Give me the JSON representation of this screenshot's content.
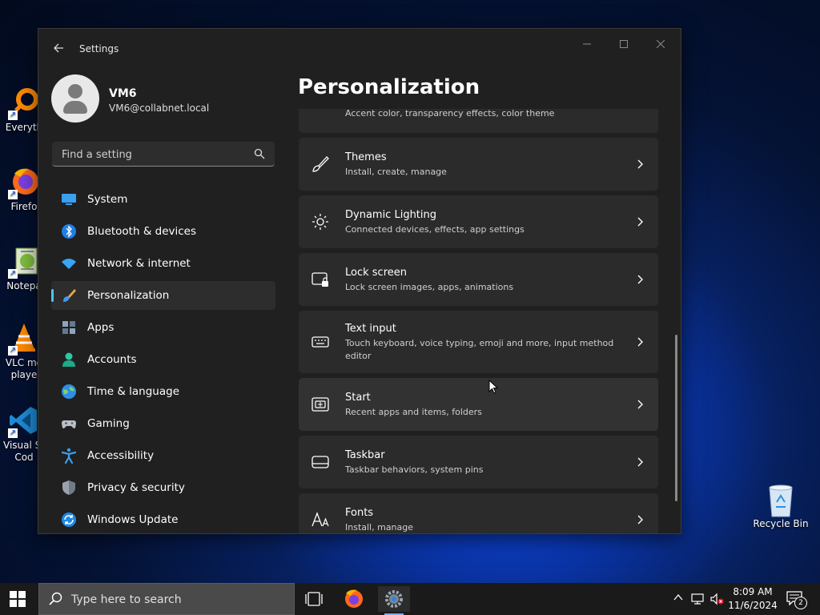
{
  "desktop": {
    "icons": [
      {
        "label": "Everyth",
        "icon": "everything-icon"
      },
      {
        "label": "Firefo",
        "icon": "firefox-icon"
      },
      {
        "label": "Notepa",
        "icon": "notepad-icon"
      },
      {
        "label": "VLC me",
        "label2": "playe",
        "icon": "vlc-icon"
      },
      {
        "label": "Visual St",
        "label2": "Cod",
        "icon": "vscode-icon"
      },
      {
        "label": "Recycle Bin",
        "icon": "recycle-bin-icon"
      }
    ]
  },
  "window": {
    "title": "Settings",
    "controls": {
      "minimize": "—",
      "maximize": "☐",
      "close": "✕"
    }
  },
  "profile": {
    "name": "VM6",
    "email": "VM6@collabnet.local"
  },
  "search": {
    "placeholder": "Find a setting"
  },
  "nav": {
    "items": [
      {
        "label": "System",
        "icon": "system-icon"
      },
      {
        "label": "Bluetooth & devices",
        "icon": "bluetooth-icon"
      },
      {
        "label": "Network & internet",
        "icon": "network-icon"
      },
      {
        "label": "Personalization",
        "icon": "personalization-icon",
        "active": true
      },
      {
        "label": "Apps",
        "icon": "apps-icon"
      },
      {
        "label": "Accounts",
        "icon": "accounts-icon"
      },
      {
        "label": "Time & language",
        "icon": "time-language-icon"
      },
      {
        "label": "Gaming",
        "icon": "gaming-icon"
      },
      {
        "label": "Accessibility",
        "icon": "accessibility-icon"
      },
      {
        "label": "Privacy & security",
        "icon": "privacy-icon"
      },
      {
        "label": "Windows Update",
        "icon": "windows-update-icon"
      }
    ]
  },
  "page": {
    "title": "Personalization",
    "cards": [
      {
        "title": "",
        "subtitle": "Accent color, transparency effects, color theme",
        "icon": "colors-icon"
      },
      {
        "title": "Themes",
        "subtitle": "Install, create, manage",
        "icon": "brush-icon"
      },
      {
        "title": "Dynamic Lighting",
        "subtitle": "Connected devices, effects, app settings",
        "icon": "lighting-icon"
      },
      {
        "title": "Lock screen",
        "subtitle": "Lock screen images, apps, animations",
        "icon": "lock-screen-icon"
      },
      {
        "title": "Text input",
        "subtitle": "Touch keyboard, voice typing, emoji and more, input method editor",
        "icon": "keyboard-icon"
      },
      {
        "title": "Start",
        "subtitle": "Recent apps and items, folders",
        "icon": "start-icon"
      },
      {
        "title": "Taskbar",
        "subtitle": "Taskbar behaviors, system pins",
        "icon": "taskbar-icon"
      },
      {
        "title": "Fonts",
        "subtitle": "Install, manage",
        "icon": "fonts-icon"
      }
    ]
  },
  "taskbar": {
    "search_text": "Type here to search",
    "time": "8:09 AM",
    "date": "11/6/2024",
    "notification_count": "2"
  },
  "colors": {
    "accent": "#4cc2ff",
    "window_bg": "#202020",
    "card_bg": "#2b2b2b"
  }
}
